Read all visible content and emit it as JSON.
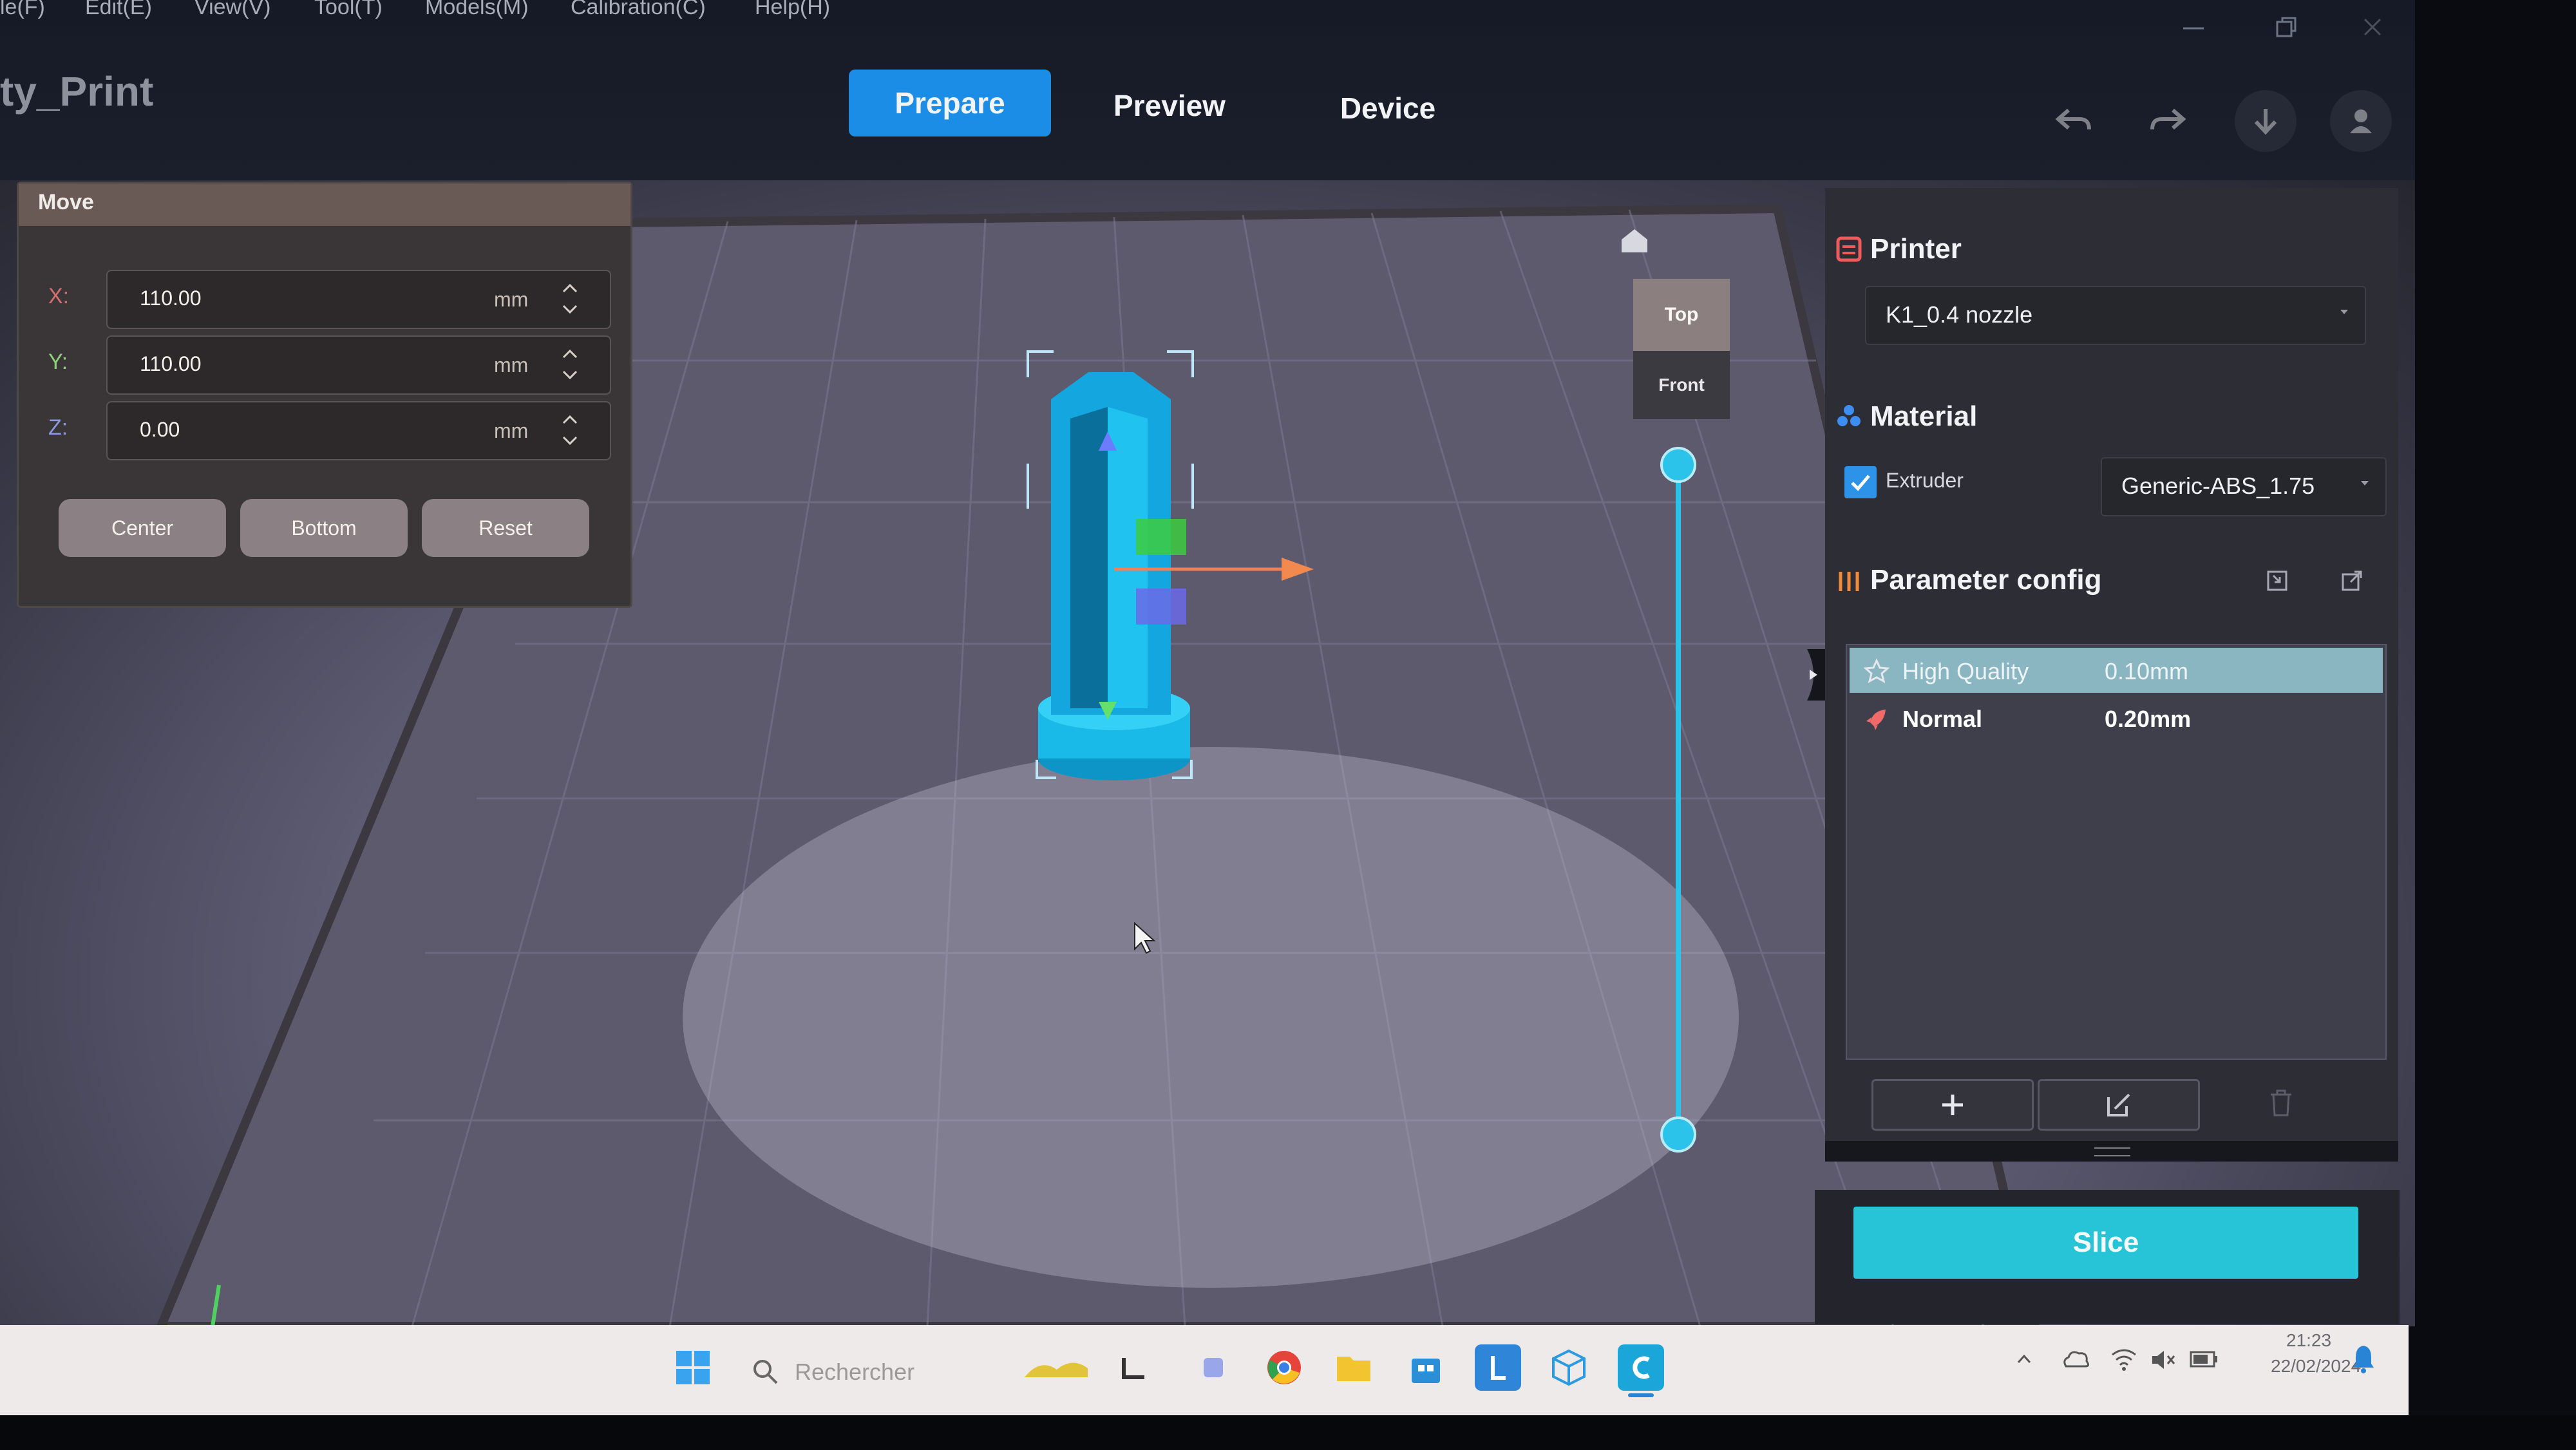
{
  "menu": {
    "items": [
      "le(F)",
      "Edit(E)",
      "View(V)",
      "Tool(T)",
      "Models(M)",
      "Calibration(C)",
      "Help(H)"
    ]
  },
  "header": {
    "title": "ty_Print",
    "tabs": [
      "Prepare",
      "Preview",
      "Device"
    ],
    "active_tab": "Prepare"
  },
  "move_panel": {
    "title": "Move",
    "fields": [
      {
        "axis": "X:",
        "value": "110.00",
        "unit": "mm"
      },
      {
        "axis": "Y:",
        "value": "110.00",
        "unit": "mm"
      },
      {
        "axis": "Z:",
        "value": "0.00",
        "unit": "mm"
      }
    ],
    "buttons": [
      "Center",
      "Bottom",
      "Reset"
    ]
  },
  "view_cube": {
    "top": "Top",
    "front": "Front"
  },
  "printer": {
    "title": "Printer",
    "selected": "K1_0.4 nozzle"
  },
  "material": {
    "title": "Material",
    "extruder_label": "Extruder",
    "extruder_checked": true,
    "selected": "Generic-ABS_1.75"
  },
  "parameter_config": {
    "title": "Parameter config",
    "profiles": [
      {
        "name": "High Quality",
        "value": "0.10mm",
        "selected": true
      },
      {
        "name": "Normal",
        "value": "0.20mm",
        "selected": false
      }
    ]
  },
  "slice_label": "Slice",
  "taskbar": {
    "search_placeholder": "Rechercher",
    "time": "21:23",
    "date": "22/02/2024"
  },
  "colors": {
    "accent_blue": "#1c8de6",
    "slice_cyan": "#27c4d8",
    "model_cyan": "#19b9e8",
    "panel_dark": "#2d2e35"
  }
}
